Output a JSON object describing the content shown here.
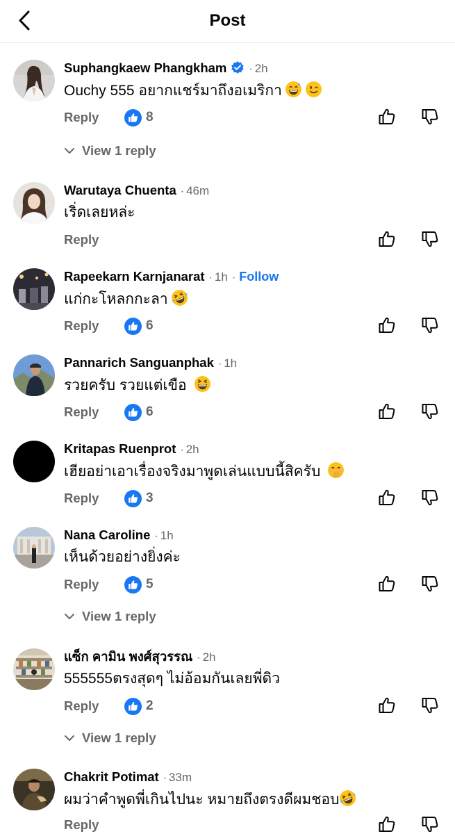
{
  "header": {
    "title": "Post",
    "back_icon": "chevron-left-icon"
  },
  "labels": {
    "reply": "Reply",
    "view_replies": "View 1 reply",
    "follow": "Follow",
    "separator": "·"
  },
  "colors": {
    "accent": "#1877f2",
    "secondary_text": "#65676b",
    "divider": "#e4e6eb"
  },
  "comments": [
    {
      "author": "Suphangkaew Phangkham",
      "verified": true,
      "time": "2h",
      "text": "Ouchy 555 อยากแชร์มาถึงอเมริกา",
      "emojis": [
        "grinning-sweat-emoji",
        "winking-emoji"
      ],
      "likes": "8",
      "replies": "View 1 reply"
    },
    {
      "author": "Warutaya Chuenta",
      "time": "46m",
      "text": "เริ่ดเลยหล่ะ"
    },
    {
      "author": "Rapeekarn Karnjanarat",
      "time": "1h",
      "follow": "Follow",
      "text": "แก่กะโหลกกะลา",
      "emojis": [
        "rofl-emoji"
      ],
      "likes": "6"
    },
    {
      "author": "Pannarich Sanguanphak",
      "time": "1h",
      "text": "รวยครับ รวยแต่เขือ",
      "emojis": [
        "grinning-squinting-emoji"
      ],
      "likes": "6"
    },
    {
      "author": "Kritapas Ruenprot",
      "time": "2h",
      "text": "เฮียอย่าเอาเรื่องจริงมาพูดเล่นแบบนี้สิครับ",
      "emojis": [
        "hand-over-mouth-emoji"
      ],
      "likes": "3"
    },
    {
      "author": "Nana Caroline",
      "time": "1h",
      "text": "เห็นด้วยอย่างยิ่งค่ะ",
      "likes": "5",
      "replies": "View 1 reply"
    },
    {
      "author": "แซ็ก คามิน พงศ์สุวรรณ",
      "time": "2h",
      "text": "555555ตรงสุดๆ ไม่อ้อมกันเลยพี่ดิว",
      "likes": "2",
      "replies": "View 1 reply"
    },
    {
      "author": "Chakrit Potimat",
      "time": "33m",
      "text": "ผมว่าคำพูดพี่เกินไปนะ หมายถึงตรงดีผมชอบ",
      "emojis": [
        "rofl-emoji"
      ]
    }
  ]
}
